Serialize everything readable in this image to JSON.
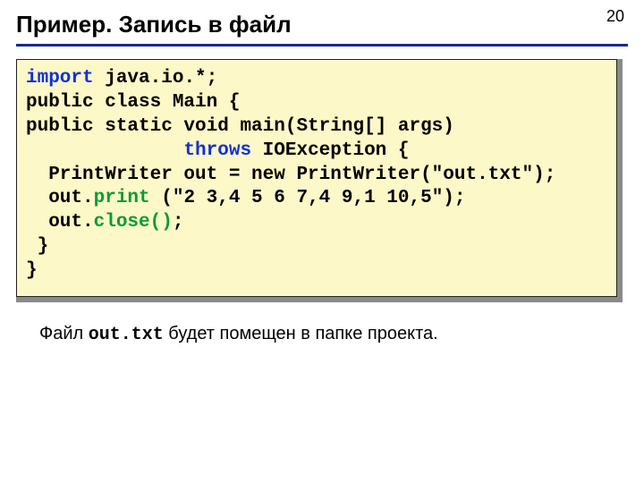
{
  "page_number": "20",
  "title": "Пример. Запись в файл",
  "code": {
    "l1a": "import",
    "l1b": " java.io.*;",
    "l2": "public class Main {",
    "l3": "public static void main(String[] args)",
    "l4_indent": "              ",
    "l4a": "throws",
    "l4b": " IOException {",
    "l5": "  PrintWriter out = new PrintWriter(\"out.txt\");",
    "l6a": "  out.",
    "l6b": "print",
    "l6c": " (\"2 3,4 5 6 7,4 9,1 10,5\");",
    "l7a": "  out.",
    "l7b": "close()",
    "l7c": ";",
    "l8": " }",
    "l9": "}"
  },
  "note": {
    "pre": "Файл ",
    "file": "out.txt",
    "post": "  будет помещен в папке проекта."
  }
}
